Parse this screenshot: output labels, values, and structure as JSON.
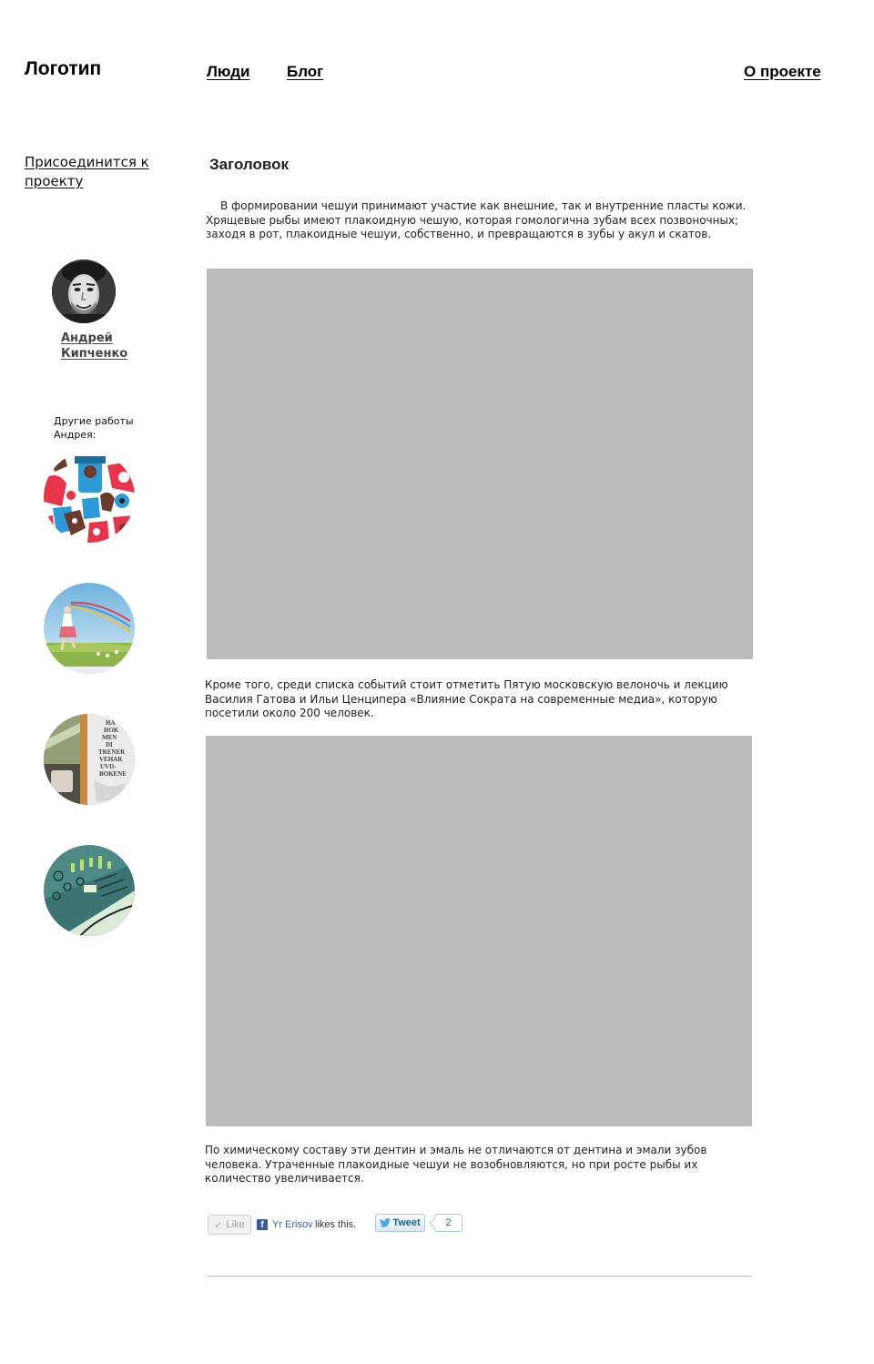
{
  "header": {
    "logo": "Логотип",
    "nav": {
      "people": "Люди",
      "blog": "Блог",
      "about": "О проекте"
    }
  },
  "sidebar": {
    "join_link": "Присоединится к проекту",
    "author": {
      "first_name": "Андрей",
      "last_name": "Кипченко"
    },
    "other_works_label": "Другие работы Андрея:",
    "works": [
      {
        "icon": "colorful-pattern-thumbnail"
      },
      {
        "icon": "girl-with-kite-thumbnail"
      },
      {
        "icon": "books-poster-thumbnail"
      },
      {
        "icon": "teal-map-thumbnail"
      }
    ]
  },
  "article": {
    "heading": "Заголовок",
    "paragraphs": [
      "В формировании чешуи принимают участие как внешние, так и внутренние пласты кожи. Хрящевые рыбы имеют плакоидную чешую, которая гомологична зубам всех позвоночных; заходя в рот, плакоидные чешуи, собственно, и превращаются в зубы у акул и скатов.",
      "Кроме того, среди списка событий стоит отметить Пятую московскую велоночь и лекцию Василия Гатова и Ильи Ценципера «Влияние Сократа на современные медиа», которую посетили около 200 человек.",
      "По химическому составу эти дентин и эмаль не отличаются от дентина и эмали зубов человека. Утраченные плакоидные чешуи не возобновляются, но при росте рыбы их количество увеличивается."
    ],
    "image_placeholder_color": "#bbbbbd"
  },
  "social": {
    "like_label": "Like",
    "fb_letter": "f",
    "fb_user": "Yr Erisov",
    "fb_likes_text": "likes this.",
    "tweet_label": "Tweet",
    "tweet_count": "2",
    "colors": {
      "facebook": "#3b5998",
      "twitter": "#186487"
    }
  }
}
